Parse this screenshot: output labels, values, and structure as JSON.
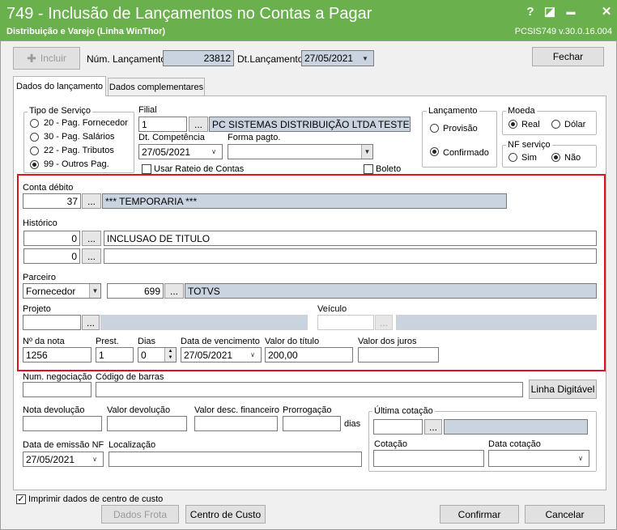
{
  "window": {
    "title": "749 - Inclusão de Lançamentos no Contas a Pagar",
    "subtitle": "Distribuição e Varejo (Linha WinThor)",
    "version": "PCSIS749  v.30.0.16.004",
    "help_label": "?",
    "restore_label": "◪",
    "minimize_label": "▬",
    "close_label": "✕"
  },
  "toolbar": {
    "incluir_label": "Incluir",
    "num_lancamento_label": "Núm. Lançamento",
    "num_lancamento_value": "23812",
    "dt_lancamento_label": "Dt.Lançamento",
    "dt_lancamento_value": "27/05/2021",
    "fechar_label": "Fechar"
  },
  "tabs": [
    {
      "label": "Dados do lançamento"
    },
    {
      "label": "Dados complementares"
    }
  ],
  "tipo_servico": {
    "label": "Tipo de Serviço",
    "options": [
      {
        "label": "20 - Pag. Fornecedor",
        "selected": false
      },
      {
        "label": "30 - Pag. Salários",
        "selected": false
      },
      {
        "label": "22 - Pag. Tributos",
        "selected": false
      },
      {
        "label": "99 - Outros Pag.",
        "selected": true
      }
    ]
  },
  "filial": {
    "label": "Filial",
    "code": "1",
    "dots": "...",
    "name": "PC SISTEMAS DISTRIBUIÇÃO LTDA TESTE"
  },
  "dt_competencia": {
    "label": "Dt. Competência",
    "value": "27/05/2021"
  },
  "forma_pagto": {
    "label": "Forma pagto.",
    "value": ""
  },
  "usar_rateio_label": "Usar Rateio de Contas",
  "boleto_label": "Boleto",
  "lancamento": {
    "label": "Lançamento",
    "provisao_label": "Provisão",
    "confirmado_label": "Confirmado"
  },
  "moeda": {
    "label": "Moeda",
    "real_label": "Real",
    "dolar_label": "Dólar"
  },
  "nf_servico": {
    "label": "NF serviço",
    "sim_label": "Sim",
    "nao_label": "Não"
  },
  "conta_debito": {
    "label": "Conta débito",
    "code": "37",
    "dots": "...",
    "name": "*** TEMPORARIA ***"
  },
  "historico": {
    "label": "Histórico",
    "row1_code": "0",
    "row1_text": "INCLUSAO DE TITULO",
    "row2_code": "0",
    "row2_text": "",
    "dots": "..."
  },
  "parceiro": {
    "label": "Parceiro",
    "type": "Fornecedor",
    "code": "699",
    "dots": "...",
    "name": "TOTVS"
  },
  "projeto": {
    "label": "Projeto",
    "dots": "..."
  },
  "veiculo": {
    "label": "Veículo",
    "dots": "..."
  },
  "titulo": {
    "nota_label": "Nº da nota",
    "nota_value": "1256",
    "prest_label": "Prest.",
    "prest_value": "1",
    "dias_label": "Dias",
    "dias_value": "0",
    "vencimento_label": "Data de vencimento",
    "vencimento_value": "27/05/2021",
    "valor_label": "Valor do título",
    "valor_value": "200,00",
    "juros_label": "Valor dos juros",
    "juros_value": ""
  },
  "num_negociacao_label": "Num. negociação",
  "codigo_barras_label": "Código de barras",
  "linha_digitavel_label": "Linha Digitável",
  "nota_devolucao_label": "Nota devolução",
  "valor_devolucao_label": "Valor devolução",
  "valor_desc_label": "Valor desc. financeiro",
  "prorrogacao_label": "Prorrogação",
  "dias_suffix": "dias",
  "ultima_cotacao": {
    "label": "Última cotação",
    "dots": "...",
    "cotacao_label": "Cotação",
    "data_cotacao_label": "Data cotação"
  },
  "data_emissao": {
    "label": "Data de emissão NF",
    "value": "27/05/2021"
  },
  "localizacao_label": "Localização",
  "footer": {
    "imprimir_label": "Imprimir dados de centro de custo",
    "dados_frota_label": "Dados Frota",
    "centro_custo_label": "Centro de Custo",
    "confirmar_label": "Confirmar",
    "cancelar_label": "Cancelar"
  },
  "colors": {
    "titlebar": "#6ab04c",
    "highlight": "#e0121e",
    "readonly_field": "#c9d4e0"
  }
}
